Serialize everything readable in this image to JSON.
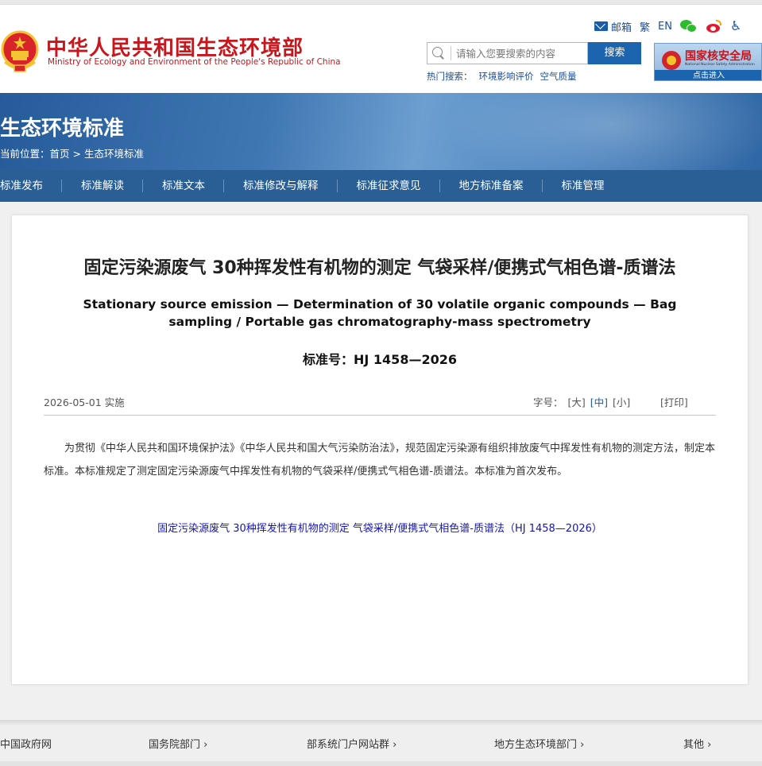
{
  "header": {
    "logo_cn": "中华人民共和国生态环境部",
    "logo_en": "Ministry of Ecology and Environment of the People's Republic of China",
    "toplinks": {
      "mail": "邮箱",
      "traditional": "繁",
      "english": "EN"
    },
    "search": {
      "placeholder": "请输入您要搜索的内容",
      "button": "搜索",
      "hot_label": "热门搜索：",
      "hot_terms": [
        "环境影响评价",
        "空气质量"
      ]
    },
    "nsa": {
      "title": "国家核安全局",
      "subtitle": "National Nuclear Safety Administration",
      "enter": "点击进入"
    }
  },
  "banner": {
    "title": "生态环境标准",
    "breadcrumb_label": "当前位置：",
    "breadcrumb_home": "首页",
    "breadcrumb_sep": " > ",
    "breadcrumb_current": "生态环境标准"
  },
  "nav": [
    "标准发布",
    "标准解读",
    "标准文本",
    "标准修改与解释",
    "标准征求意见",
    "地方标准备案",
    "标准管理"
  ],
  "article": {
    "title_cn": "固定污染源废气 30种挥发性有机物的测定 气袋采样/便携式气相色谱-质谱法",
    "title_en": "Stationary source emission — Determination of 30 volatile organic compounds — Bag sampling / Portable gas chromatography-mass spectrometry",
    "standard_no": "标准号：HJ 1458—2026",
    "date": "2026-05-01 实施",
    "font_label": "字号：",
    "font_options": [
      "[大]",
      "[中]",
      "[小]"
    ],
    "font_active": "[中]",
    "print": "[打印]",
    "body": "为贯彻《中华人民共和国环境保护法》《中华人民共和国大气污染防治法》，规范固定污染源有组织排放废气中挥发性有机物的测定方法，制定本标准。本标准规定了测定固定污染源废气中挥发性有机物的气袋采样/便携式气相色谱-质谱法。本标准为首次发布。",
    "link": "固定污染源废气 30种挥发性有机物的测定 气袋采样/便携式气相色谱-质谱法（HJ 1458—2026）"
  },
  "footer": {
    "links": [
      "中国政府网",
      "国务院部门 ›",
      "部系统门户网站群 ›",
      "地方生态环境部门 ›",
      "其他 ›"
    ]
  },
  "colors": {
    "brand_red": "#c8161d",
    "nav_blue": "#2a5f96",
    "link_blue": "#1414b4"
  }
}
